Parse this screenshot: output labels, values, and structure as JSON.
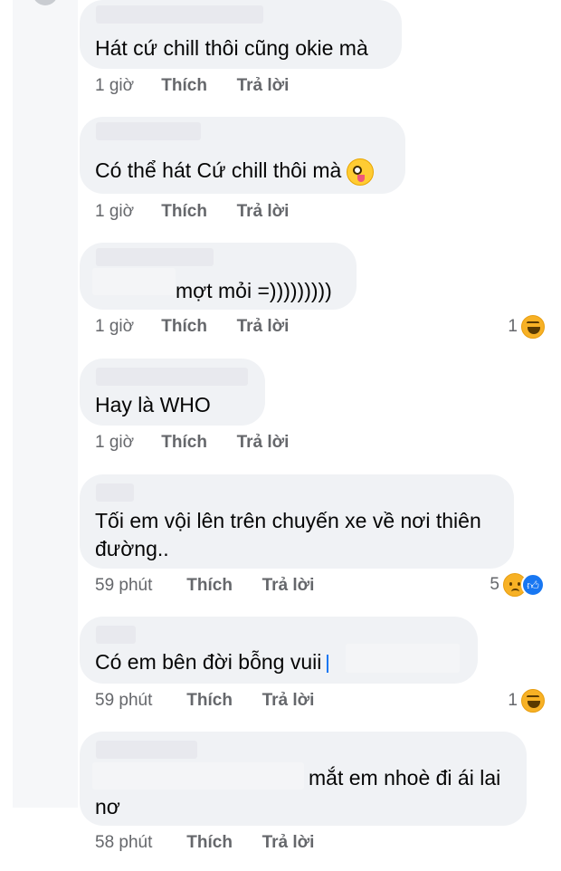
{
  "comments": [
    {
      "text": "Hát cứ chill thôi cũng okie mà",
      "time": "1 giờ",
      "like_label": "Thích",
      "reply_label": "Trả lời"
    },
    {
      "text": "Có thể hát Cứ chill thôi mà",
      "emoji": "silly-face-icon",
      "time": "1 giờ",
      "like_label": "Thích",
      "reply_label": "Trả lời"
    },
    {
      "text": "mợt mỏi =)))))))))",
      "time": "1 giờ",
      "like_label": "Thích",
      "reply_label": "Trả lời",
      "reaction_count": "1",
      "reactions": [
        "haha-icon"
      ]
    },
    {
      "text": "Hay là WHO",
      "time": "1 giờ",
      "like_label": "Thích",
      "reply_label": "Trả lời"
    },
    {
      "text_line1": "Tối em vội lên trên chuyến xe về nơi thiên",
      "text_line2": "đường..",
      "time": "59 phút",
      "like_label": "Thích",
      "reply_label": "Trả lời",
      "reaction_count": "5",
      "reactions": [
        "sad-icon",
        "like-icon"
      ]
    },
    {
      "text": "Có em bên đời bỗng vuii",
      "time": "59 phút",
      "like_label": "Thích",
      "reply_label": "Trả lời",
      "reaction_count": "1",
      "reactions": [
        "haha-icon"
      ]
    },
    {
      "text_line1": "mắt em nhoè đi ái lai",
      "text_line2": "nơ",
      "time": "58 phút",
      "like_label": "Thích",
      "reply_label": "Trả lời"
    }
  ],
  "colors": {
    "bubble": "#f0f2f5",
    "meta_text": "#65676b",
    "like_blue": "#1877f2",
    "reaction_yellow": "#f7b125"
  }
}
